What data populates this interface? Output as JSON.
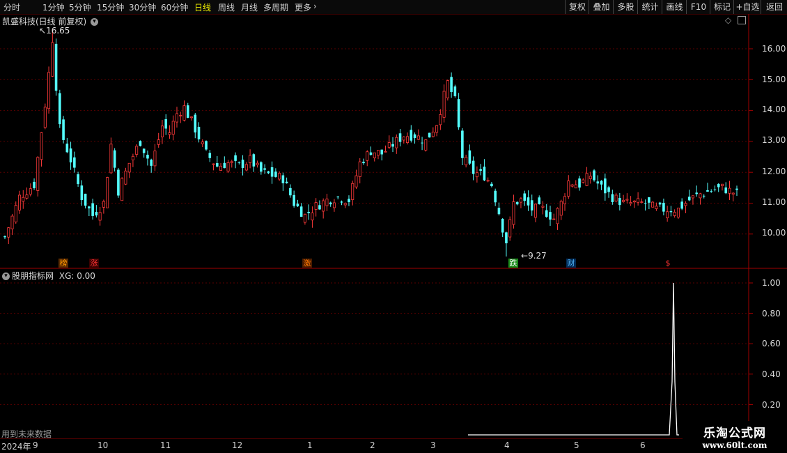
{
  "toolbar": {
    "left_items": [
      {
        "label": "分时",
        "active": false
      },
      {
        "label": "1分钟",
        "active": false
      },
      {
        "label": "5分钟",
        "active": false
      },
      {
        "label": "15分钟",
        "active": false
      },
      {
        "label": "30分钟",
        "active": false
      },
      {
        "label": "60分钟",
        "active": false
      },
      {
        "label": "日线",
        "active": true
      },
      {
        "label": "周线",
        "active": false
      },
      {
        "label": "月线",
        "active": false
      },
      {
        "label": "多周期",
        "active": false
      },
      {
        "label": "更多",
        "active": false
      }
    ],
    "right_items": [
      "复权",
      "叠加",
      "多股",
      "统计",
      "画线",
      "F10",
      "标记",
      "+自选",
      "返回"
    ]
  },
  "main_panel": {
    "title": "凯盛科技(日线 前复权)",
    "max_label": "16.65",
    "min_label": "9.27",
    "y_ticks": [
      "16.00",
      "15.00",
      "14.00",
      "13.00",
      "12.00",
      "11.00",
      "10.00"
    ],
    "signals": [
      {
        "text": "榜",
        "color": "#ff9900",
        "bg": "#5a2a00"
      },
      {
        "text": "涨",
        "color": "#ff3333",
        "bg": "#3a0000"
      },
      {
        "text": "激",
        "color": "#ff7700",
        "bg": "#4a1c00"
      },
      {
        "text": "跌",
        "color": "#ffffff",
        "bg": "#1a8a1a"
      },
      {
        "text": "财",
        "color": "#55bbff",
        "bg": "#002a55"
      },
      {
        "text": "$",
        "color": "#ff3333",
        "bg": "#000000"
      }
    ]
  },
  "indicator_panel": {
    "title": "股朋指标网",
    "value_label": "XG: 0.00",
    "y_ticks": [
      "1.00",
      "0.80",
      "0.60",
      "0.40",
      "0.20"
    ],
    "warning": "用到未来数据"
  },
  "x_axis": {
    "year_label": "2024年",
    "months": [
      "9",
      "10",
      "11",
      "12",
      "1",
      "2",
      "3",
      "4",
      "5",
      "6"
    ]
  },
  "watermark": {
    "name": "乐淘公式网",
    "url": "www.60lt.com"
  },
  "chart_data": {
    "type": "candlestick",
    "title": "凯盛科技(日线 前复权)",
    "ylim": [
      9.0,
      16.9
    ],
    "annotations": [
      {
        "label": "16.65",
        "type": "max"
      },
      {
        "label": "9.27",
        "type": "min"
      }
    ],
    "anchors": [
      {
        "i": 0,
        "c": 9.9
      },
      {
        "i": 4,
        "c": 11.2
      },
      {
        "i": 8,
        "c": 11.6
      },
      {
        "i": 11,
        "c": 14.2
      },
      {
        "i": 13,
        "c": 16.2
      },
      {
        "i": 15,
        "c": 13.4
      },
      {
        "i": 18,
        "c": 12.4
      },
      {
        "i": 21,
        "c": 11.2
      },
      {
        "i": 24,
        "c": 10.6
      },
      {
        "i": 27,
        "c": 11.0
      },
      {
        "i": 29,
        "c": 12.9
      },
      {
        "i": 31,
        "c": 11.4
      },
      {
        "i": 34,
        "c": 12.3
      },
      {
        "i": 37,
        "c": 13.0
      },
      {
        "i": 40,
        "c": 12.2
      },
      {
        "i": 43,
        "c": 13.5
      },
      {
        "i": 45,
        "c": 13.3
      },
      {
        "i": 47,
        "c": 13.9
      },
      {
        "i": 49,
        "c": 14.1
      },
      {
        "i": 52,
        "c": 13.4
      },
      {
        "i": 55,
        "c": 12.6
      },
      {
        "i": 58,
        "c": 12.2
      },
      {
        "i": 61,
        "c": 12.3
      },
      {
        "i": 64,
        "c": 12.2
      },
      {
        "i": 67,
        "c": 12.4
      },
      {
        "i": 70,
        "c": 12.0
      },
      {
        "i": 73,
        "c": 11.9
      },
      {
        "i": 76,
        "c": 11.8
      },
      {
        "i": 79,
        "c": 11.0
      },
      {
        "i": 82,
        "c": 10.6
      },
      {
        "i": 85,
        "c": 10.9
      },
      {
        "i": 88,
        "c": 11.1
      },
      {
        "i": 91,
        "c": 11.2
      },
      {
        "i": 94,
        "c": 11.1
      },
      {
        "i": 97,
        "c": 12.3
      },
      {
        "i": 100,
        "c": 12.7
      },
      {
        "i": 103,
        "c": 12.6
      },
      {
        "i": 106,
        "c": 12.9
      },
      {
        "i": 109,
        "c": 13.2
      },
      {
        "i": 112,
        "c": 13.2
      },
      {
        "i": 115,
        "c": 13.0
      },
      {
        "i": 118,
        "c": 13.6
      },
      {
        "i": 121,
        "c": 14.9
      },
      {
        "i": 123,
        "c": 14.3
      },
      {
        "i": 125,
        "c": 12.5
      },
      {
        "i": 128,
        "c": 12.0
      },
      {
        "i": 131,
        "c": 11.9
      },
      {
        "i": 133,
        "c": 11.6
      },
      {
        "i": 135,
        "c": 10.7
      },
      {
        "i": 137,
        "c": 9.7
      },
      {
        "i": 139,
        "c": 11.0
      },
      {
        "i": 141,
        "c": 11.1
      },
      {
        "i": 144,
        "c": 10.8
      },
      {
        "i": 147,
        "c": 10.8
      },
      {
        "i": 150,
        "c": 10.5
      },
      {
        "i": 152,
        "c": 11.0
      },
      {
        "i": 154,
        "c": 11.7
      },
      {
        "i": 157,
        "c": 11.6
      },
      {
        "i": 160,
        "c": 11.9
      },
      {
        "i": 163,
        "c": 11.5
      },
      {
        "i": 166,
        "c": 11.2
      },
      {
        "i": 169,
        "c": 11.0
      },
      {
        "i": 172,
        "c": 11.0
      },
      {
        "i": 175,
        "c": 11.0
      },
      {
        "i": 178,
        "c": 10.8
      },
      {
        "i": 181,
        "c": 10.8
      },
      {
        "i": 184,
        "c": 10.8
      },
      {
        "i": 187,
        "c": 11.1
      },
      {
        "i": 190,
        "c": 11.3
      },
      {
        "i": 193,
        "c": 11.4
      },
      {
        "i": 196,
        "c": 11.5
      },
      {
        "i": 198,
        "c": 11.4
      },
      {
        "i": 200,
        "c": 11.3
      }
    ],
    "indicator": {
      "name": "XG",
      "range": [
        0,
        1
      ],
      "peak": 1.0,
      "ylim": [
        0,
        1.05
      ]
    }
  }
}
